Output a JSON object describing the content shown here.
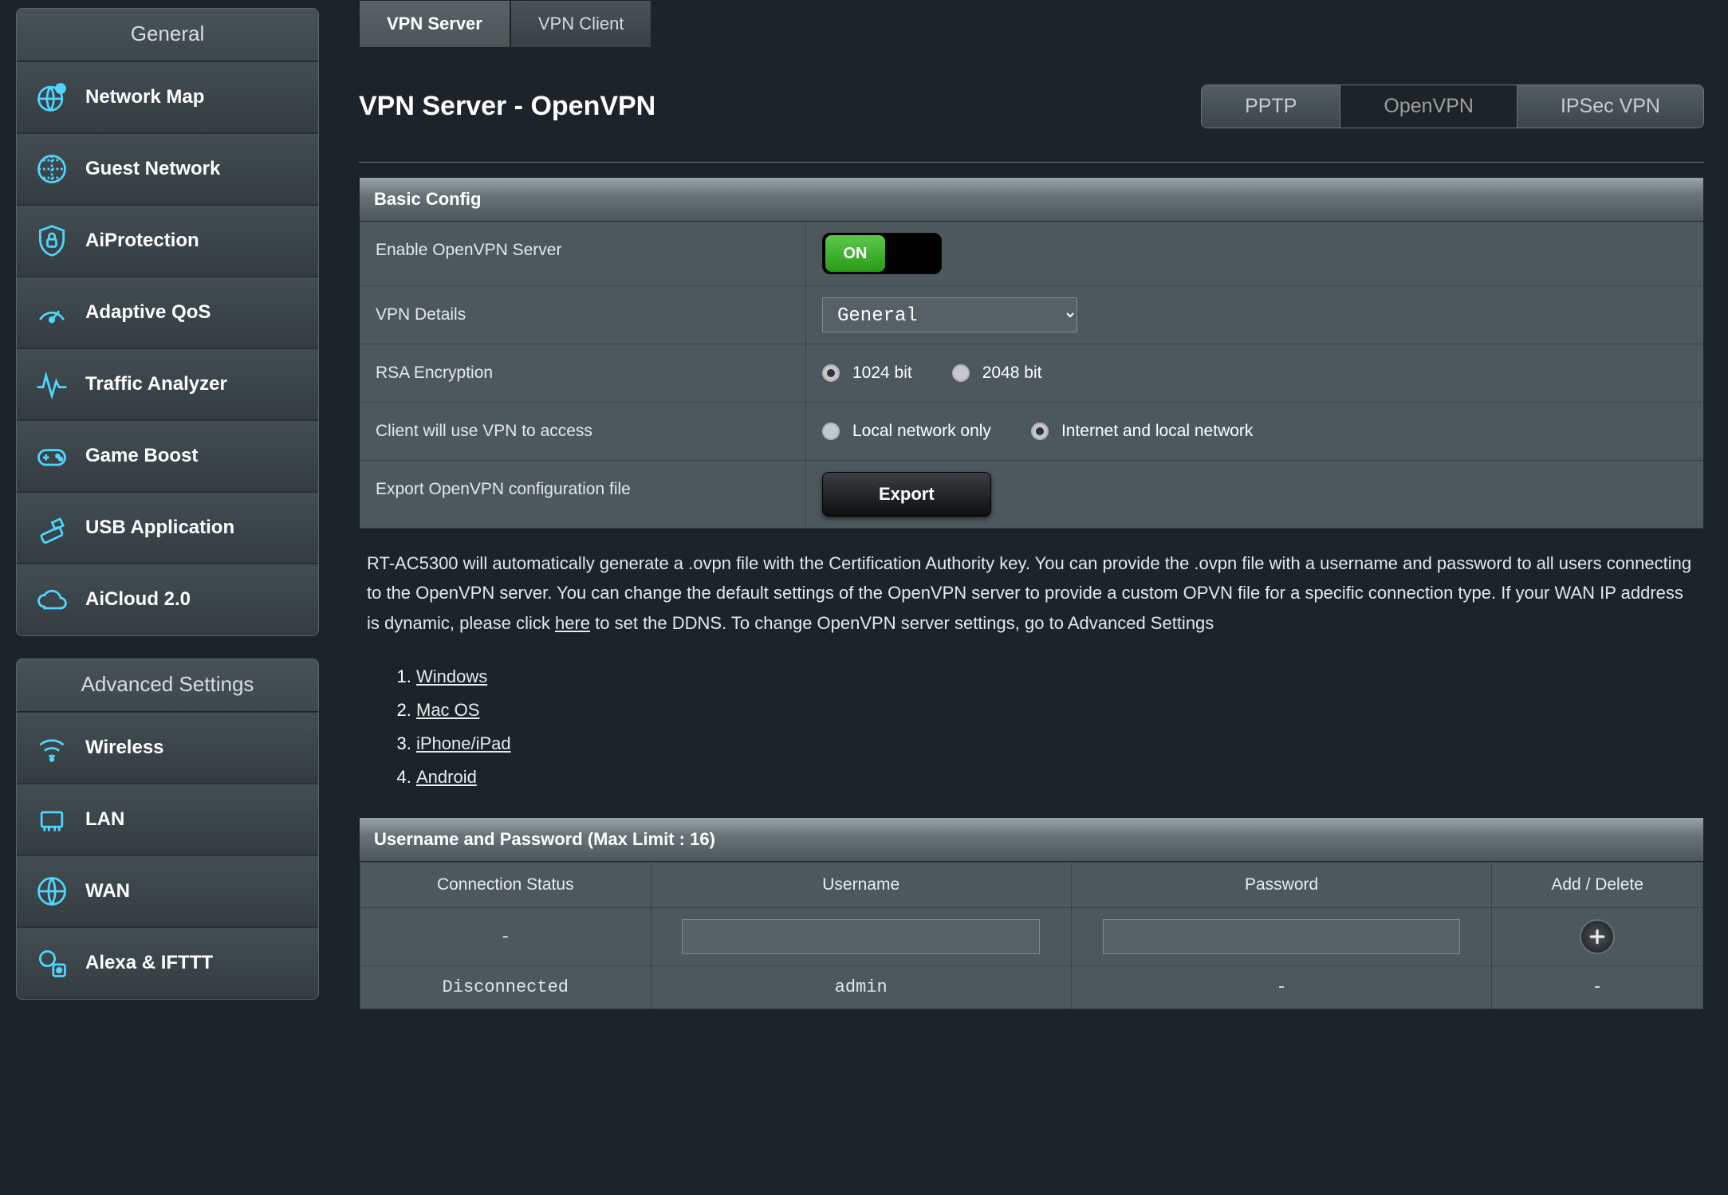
{
  "sidebar": {
    "general_title": "General",
    "advanced_title": "Advanced Settings",
    "general": [
      {
        "label": "Network Map",
        "icon": "globe-pin"
      },
      {
        "label": "Guest Network",
        "icon": "globe-grid"
      },
      {
        "label": "AiProtection",
        "icon": "shield-lock"
      },
      {
        "label": "Adaptive QoS",
        "icon": "gauge"
      },
      {
        "label": "Traffic Analyzer",
        "icon": "pulse"
      },
      {
        "label": "Game Boost",
        "icon": "gamepad"
      },
      {
        "label": "USB Application",
        "icon": "usb"
      },
      {
        "label": "AiCloud 2.0",
        "icon": "cloud"
      }
    ],
    "advanced": [
      {
        "label": "Wireless",
        "icon": "wifi"
      },
      {
        "label": "LAN",
        "icon": "ethernet"
      },
      {
        "label": "WAN",
        "icon": "globe"
      },
      {
        "label": "Alexa & IFTTT",
        "icon": "alexa"
      }
    ]
  },
  "tabs": [
    {
      "label": "VPN Server",
      "active": true
    },
    {
      "label": "VPN Client",
      "active": false
    }
  ],
  "page_title": "VPN Server - OpenVPN",
  "segments": [
    {
      "label": "PPTP",
      "active": false
    },
    {
      "label": "OpenVPN",
      "active": true
    },
    {
      "label": "IPSec VPN",
      "active": false
    }
  ],
  "basic": {
    "title": "Basic Config",
    "rows": {
      "enable_label": "Enable OpenVPN Server",
      "enable_value": "ON",
      "details_label": "VPN Details",
      "details_value": "General",
      "rsa_label": "RSA Encryption",
      "rsa_options": [
        "1024 bit",
        "2048 bit"
      ],
      "rsa_selected": "1024 bit",
      "access_label": "Client will use VPN to access",
      "access_options": [
        "Local network only",
        "Internet and local network"
      ],
      "access_selected": "Internet and local network",
      "export_label": "Export OpenVPN configuration file",
      "export_button": "Export"
    }
  },
  "description": {
    "text_before_link": "RT-AC5300 will automatically generate a .ovpn file with the Certification Authority key. You can provide the .ovpn file with a username and password to all users connecting to the OpenVPN server. You can change the default settings of the OpenVPN server to provide a custom OPVN file for a specific connection type. If your WAN IP address is dynamic, please click ",
    "link_text": "here",
    "text_after_link": " to set the DDNS. To change OpenVPN server settings, go to Advanced Settings"
  },
  "os_list": [
    "Windows",
    "Mac OS",
    "iPhone/iPad",
    "Android"
  ],
  "users": {
    "title": "Username and Password (Max Limit : 16)",
    "headers": [
      "Connection Status",
      "Username",
      "Password",
      "Add / Delete"
    ],
    "input_row": {
      "status": "-"
    },
    "rows": [
      {
        "status": "Disconnected",
        "username": "admin",
        "password": "-",
        "action": "-"
      }
    ]
  }
}
